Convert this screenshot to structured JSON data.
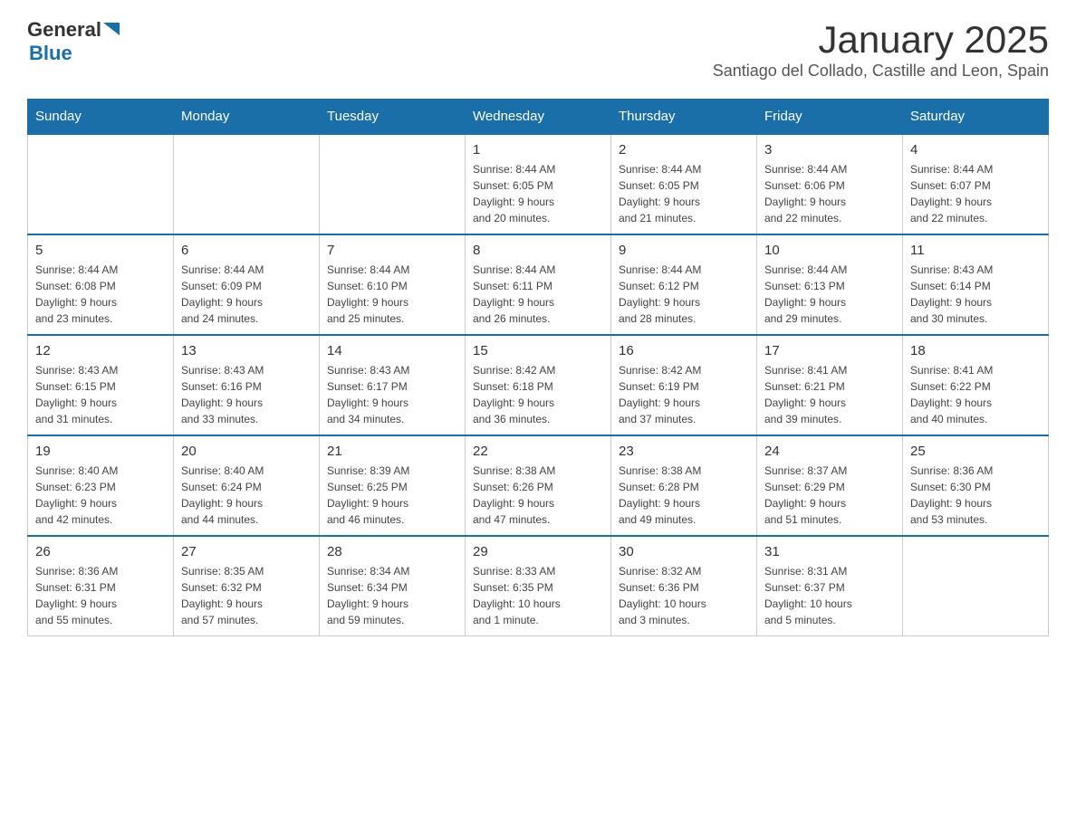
{
  "header": {
    "logo_general": "General",
    "logo_blue": "Blue",
    "month_title": "January 2025",
    "subtitle": "Santiago del Collado, Castille and Leon, Spain"
  },
  "weekdays": [
    "Sunday",
    "Monday",
    "Tuesday",
    "Wednesday",
    "Thursday",
    "Friday",
    "Saturday"
  ],
  "weeks": [
    [
      {
        "day": "",
        "info": ""
      },
      {
        "day": "",
        "info": ""
      },
      {
        "day": "",
        "info": ""
      },
      {
        "day": "1",
        "info": "Sunrise: 8:44 AM\nSunset: 6:05 PM\nDaylight: 9 hours\nand 20 minutes."
      },
      {
        "day": "2",
        "info": "Sunrise: 8:44 AM\nSunset: 6:05 PM\nDaylight: 9 hours\nand 21 minutes."
      },
      {
        "day": "3",
        "info": "Sunrise: 8:44 AM\nSunset: 6:06 PM\nDaylight: 9 hours\nand 22 minutes."
      },
      {
        "day": "4",
        "info": "Sunrise: 8:44 AM\nSunset: 6:07 PM\nDaylight: 9 hours\nand 22 minutes."
      }
    ],
    [
      {
        "day": "5",
        "info": "Sunrise: 8:44 AM\nSunset: 6:08 PM\nDaylight: 9 hours\nand 23 minutes."
      },
      {
        "day": "6",
        "info": "Sunrise: 8:44 AM\nSunset: 6:09 PM\nDaylight: 9 hours\nand 24 minutes."
      },
      {
        "day": "7",
        "info": "Sunrise: 8:44 AM\nSunset: 6:10 PM\nDaylight: 9 hours\nand 25 minutes."
      },
      {
        "day": "8",
        "info": "Sunrise: 8:44 AM\nSunset: 6:11 PM\nDaylight: 9 hours\nand 26 minutes."
      },
      {
        "day": "9",
        "info": "Sunrise: 8:44 AM\nSunset: 6:12 PM\nDaylight: 9 hours\nand 28 minutes."
      },
      {
        "day": "10",
        "info": "Sunrise: 8:44 AM\nSunset: 6:13 PM\nDaylight: 9 hours\nand 29 minutes."
      },
      {
        "day": "11",
        "info": "Sunrise: 8:43 AM\nSunset: 6:14 PM\nDaylight: 9 hours\nand 30 minutes."
      }
    ],
    [
      {
        "day": "12",
        "info": "Sunrise: 8:43 AM\nSunset: 6:15 PM\nDaylight: 9 hours\nand 31 minutes."
      },
      {
        "day": "13",
        "info": "Sunrise: 8:43 AM\nSunset: 6:16 PM\nDaylight: 9 hours\nand 33 minutes."
      },
      {
        "day": "14",
        "info": "Sunrise: 8:43 AM\nSunset: 6:17 PM\nDaylight: 9 hours\nand 34 minutes."
      },
      {
        "day": "15",
        "info": "Sunrise: 8:42 AM\nSunset: 6:18 PM\nDaylight: 9 hours\nand 36 minutes."
      },
      {
        "day": "16",
        "info": "Sunrise: 8:42 AM\nSunset: 6:19 PM\nDaylight: 9 hours\nand 37 minutes."
      },
      {
        "day": "17",
        "info": "Sunrise: 8:41 AM\nSunset: 6:21 PM\nDaylight: 9 hours\nand 39 minutes."
      },
      {
        "day": "18",
        "info": "Sunrise: 8:41 AM\nSunset: 6:22 PM\nDaylight: 9 hours\nand 40 minutes."
      }
    ],
    [
      {
        "day": "19",
        "info": "Sunrise: 8:40 AM\nSunset: 6:23 PM\nDaylight: 9 hours\nand 42 minutes."
      },
      {
        "day": "20",
        "info": "Sunrise: 8:40 AM\nSunset: 6:24 PM\nDaylight: 9 hours\nand 44 minutes."
      },
      {
        "day": "21",
        "info": "Sunrise: 8:39 AM\nSunset: 6:25 PM\nDaylight: 9 hours\nand 46 minutes."
      },
      {
        "day": "22",
        "info": "Sunrise: 8:38 AM\nSunset: 6:26 PM\nDaylight: 9 hours\nand 47 minutes."
      },
      {
        "day": "23",
        "info": "Sunrise: 8:38 AM\nSunset: 6:28 PM\nDaylight: 9 hours\nand 49 minutes."
      },
      {
        "day": "24",
        "info": "Sunrise: 8:37 AM\nSunset: 6:29 PM\nDaylight: 9 hours\nand 51 minutes."
      },
      {
        "day": "25",
        "info": "Sunrise: 8:36 AM\nSunset: 6:30 PM\nDaylight: 9 hours\nand 53 minutes."
      }
    ],
    [
      {
        "day": "26",
        "info": "Sunrise: 8:36 AM\nSunset: 6:31 PM\nDaylight: 9 hours\nand 55 minutes."
      },
      {
        "day": "27",
        "info": "Sunrise: 8:35 AM\nSunset: 6:32 PM\nDaylight: 9 hours\nand 57 minutes."
      },
      {
        "day": "28",
        "info": "Sunrise: 8:34 AM\nSunset: 6:34 PM\nDaylight: 9 hours\nand 59 minutes."
      },
      {
        "day": "29",
        "info": "Sunrise: 8:33 AM\nSunset: 6:35 PM\nDaylight: 10 hours\nand 1 minute."
      },
      {
        "day": "30",
        "info": "Sunrise: 8:32 AM\nSunset: 6:36 PM\nDaylight: 10 hours\nand 3 minutes."
      },
      {
        "day": "31",
        "info": "Sunrise: 8:31 AM\nSunset: 6:37 PM\nDaylight: 10 hours\nand 5 minutes."
      },
      {
        "day": "",
        "info": ""
      }
    ]
  ]
}
